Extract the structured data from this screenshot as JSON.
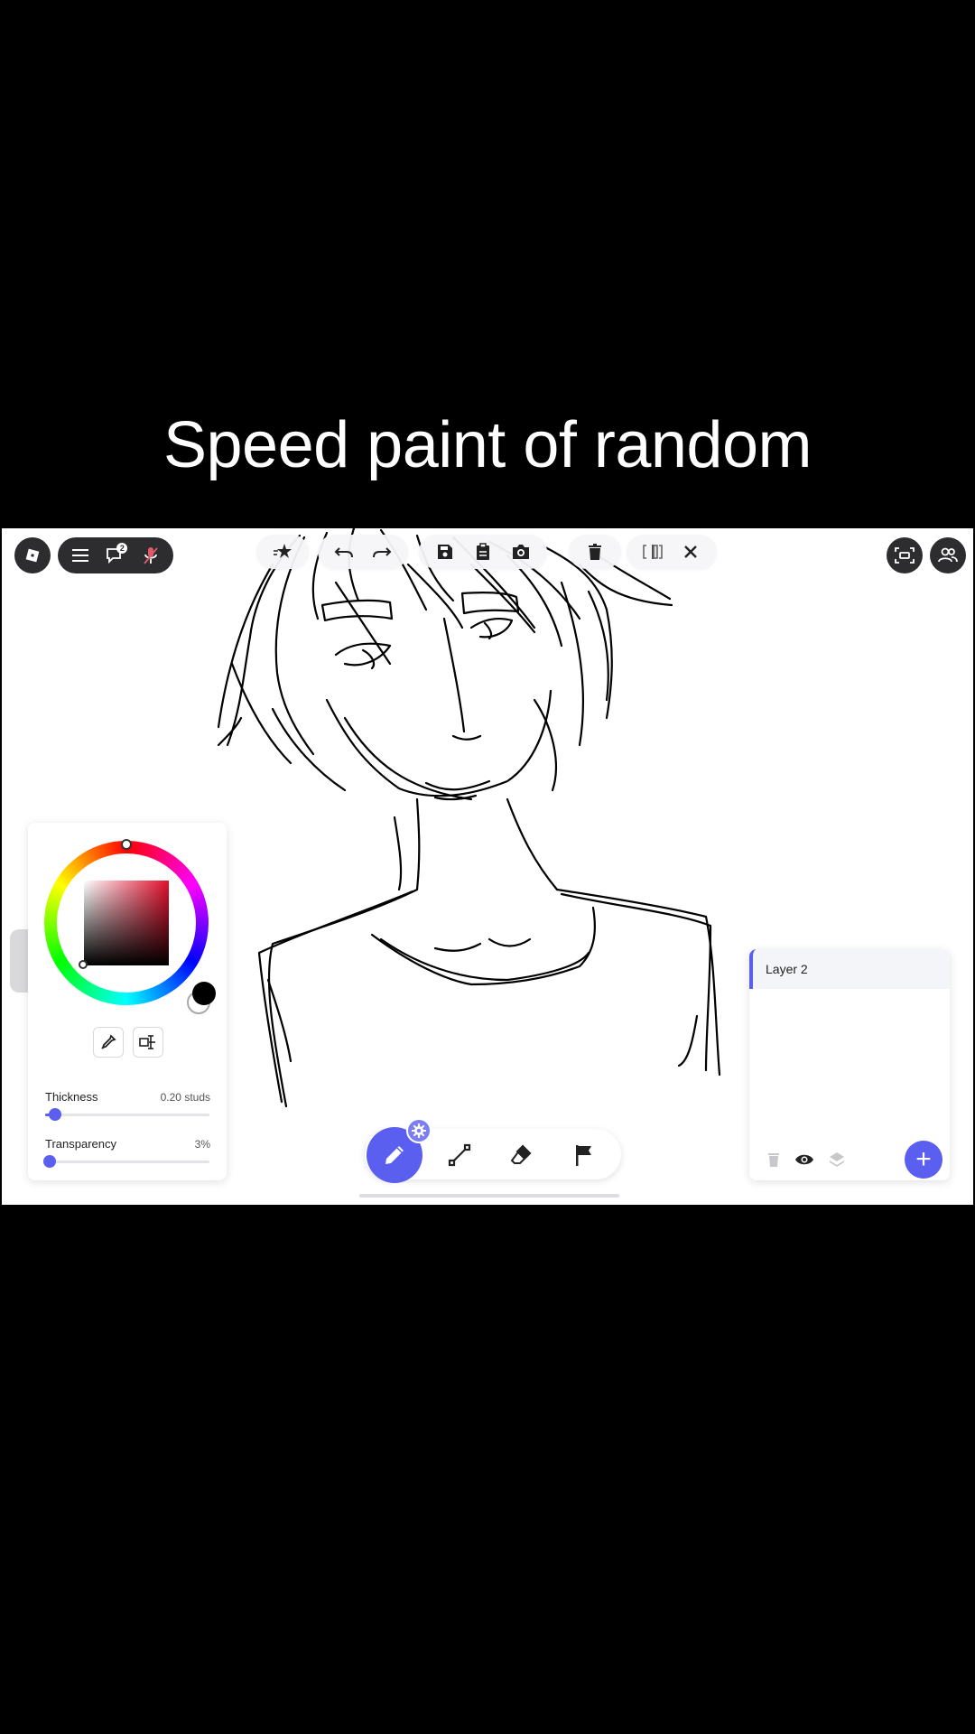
{
  "caption": "Speed paint of random",
  "top_left": {
    "logo_icon": "roblox-logo-icon",
    "menu_icon": "hamburger-menu-icon",
    "chat_icon": "chat-icon",
    "chat_badge": "2",
    "mic_icon": "microphone-muted-icon"
  },
  "toolbar": {
    "groups": [
      [
        "sparkle-star-icon"
      ],
      [
        "undo-icon",
        "redo-icon"
      ],
      [
        "save-icon",
        "clipboard-icon",
        "camera-icon"
      ],
      [
        "trash-icon"
      ],
      [
        "mirror-icon",
        "close-icon"
      ]
    ]
  },
  "top_right": {
    "screen_icon": "screen-capture-icon",
    "people_icon": "people-icon"
  },
  "color_panel": {
    "thickness_label": "Thickness",
    "thickness_value": "0.20 studs",
    "thickness_fraction": 0.06,
    "transparency_label": "Transparency",
    "transparency_value": "3%",
    "transparency_fraction": 0.03,
    "primary_color": "#000000",
    "hue_color": "#e3102d",
    "accent": "#5b5fef"
  },
  "bottom_tools": [
    "pen-icon",
    "line-icon",
    "eraser-icon",
    "flag-icon"
  ],
  "layers": {
    "items": [
      {
        "name": "Layer 2"
      }
    ],
    "add_label": "+"
  }
}
